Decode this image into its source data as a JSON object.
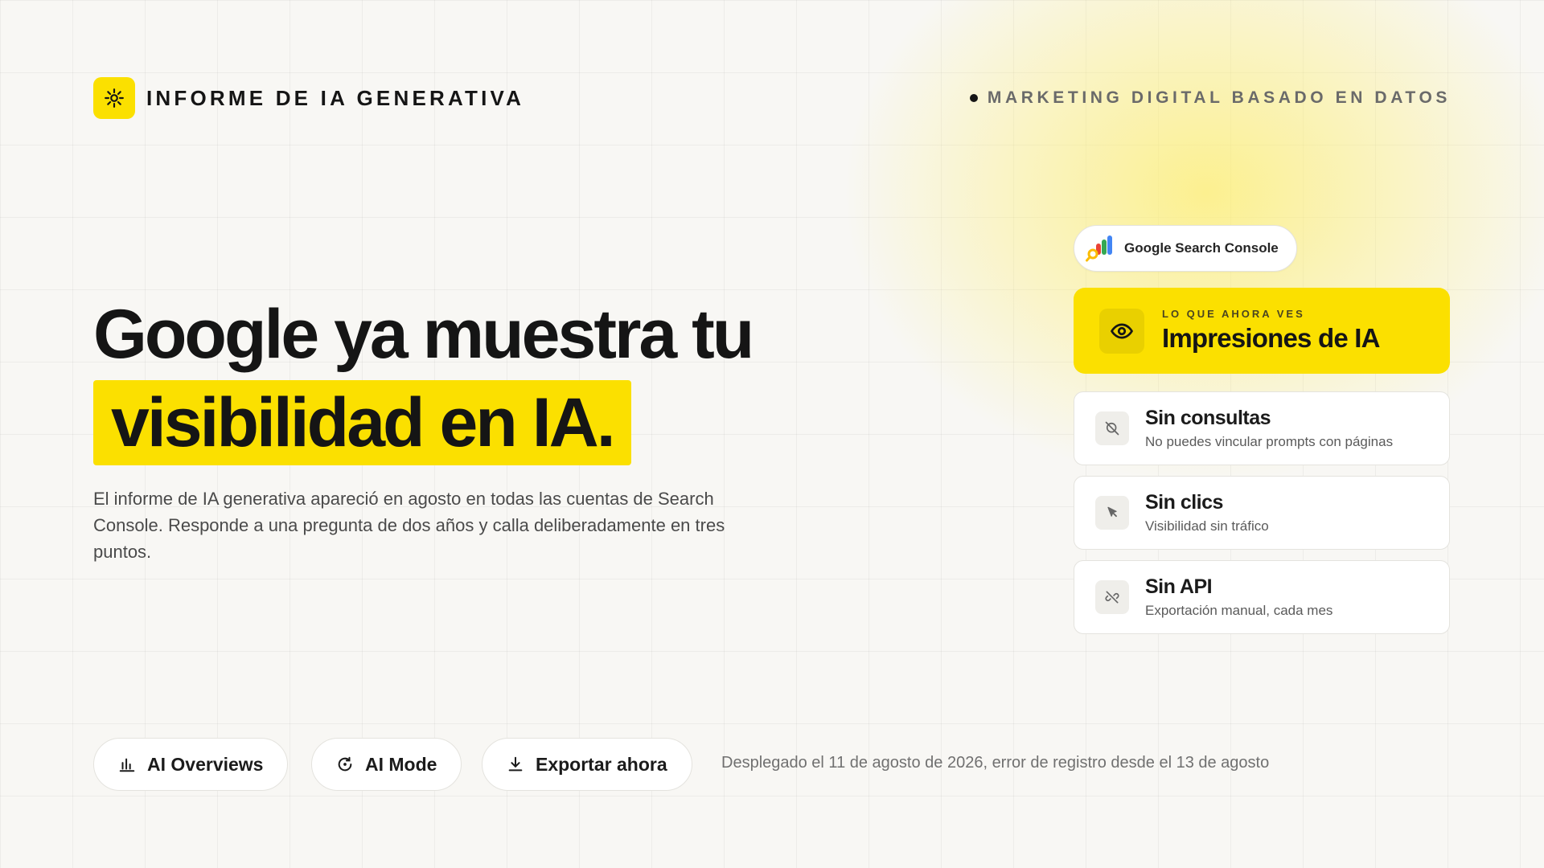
{
  "header": {
    "brand_title": "INFORME DE IA GENERATIVA",
    "brand_icon": "sun-icon",
    "tagline": "MARKETING DIGITAL BASADO EN DATOS"
  },
  "hero": {
    "headline_line1": "Google ya muestra tu",
    "headline_line2": "visibilidad en IA.",
    "lead": "El informe de IA generativa apareció en agosto en todas las cuentas de Search Console. Responde a una pregunta de dos años y calla deliberadamente en tres puntos."
  },
  "panel": {
    "source_label": "Google Search Console",
    "source_icon": "google-search-console-icon",
    "featured": {
      "kicker": "LO QUE AHORA VES",
      "title": "Impresiones de IA",
      "icon": "eye-icon"
    },
    "cards": [
      {
        "title": "Sin consultas",
        "subtitle": "No puedes vincular prompts con páginas",
        "icon": "search-off-icon"
      },
      {
        "title": "Sin clics",
        "subtitle": "Visibilidad sin tráfico",
        "icon": "cursor-icon"
      },
      {
        "title": "Sin API",
        "subtitle": "Exportación manual, cada mes",
        "icon": "link-off-icon"
      }
    ]
  },
  "actions": {
    "ai_overviews": "AI Overviews",
    "ai_mode": "AI Mode",
    "export": "Exportar ahora"
  },
  "footnote": "Desplegado el 11 de agosto de 2026, error de registro desde el 13 de agosto",
  "colors": {
    "accent": "#fbe000",
    "background": "#f8f7f4",
    "text": "#151515"
  }
}
